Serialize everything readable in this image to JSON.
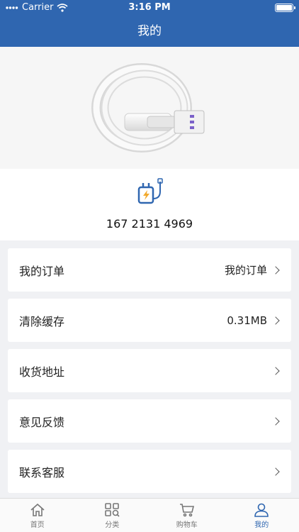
{
  "status": {
    "carrier": "Carrier",
    "time": "3:16 PM"
  },
  "nav": {
    "title": "我的"
  },
  "profile": {
    "phone": "167 2131 4969"
  },
  "menu": {
    "items": [
      {
        "label": "我的订单",
        "value": "我的订单"
      },
      {
        "label": "清除缓存",
        "value": "0.31MB"
      },
      {
        "label": "收货地址",
        "value": ""
      },
      {
        "label": "意见反馈",
        "value": ""
      },
      {
        "label": "联系客服",
        "value": ""
      }
    ]
  },
  "tabs": [
    {
      "label": "首页",
      "icon": "home-icon"
    },
    {
      "label": "分类",
      "icon": "category-icon"
    },
    {
      "label": "购物车",
      "icon": "cart-icon"
    },
    {
      "label": "我的",
      "icon": "user-icon",
      "active": true
    }
  ],
  "colors": {
    "brand": "#2f66b0",
    "background": "#f0f1f4"
  }
}
